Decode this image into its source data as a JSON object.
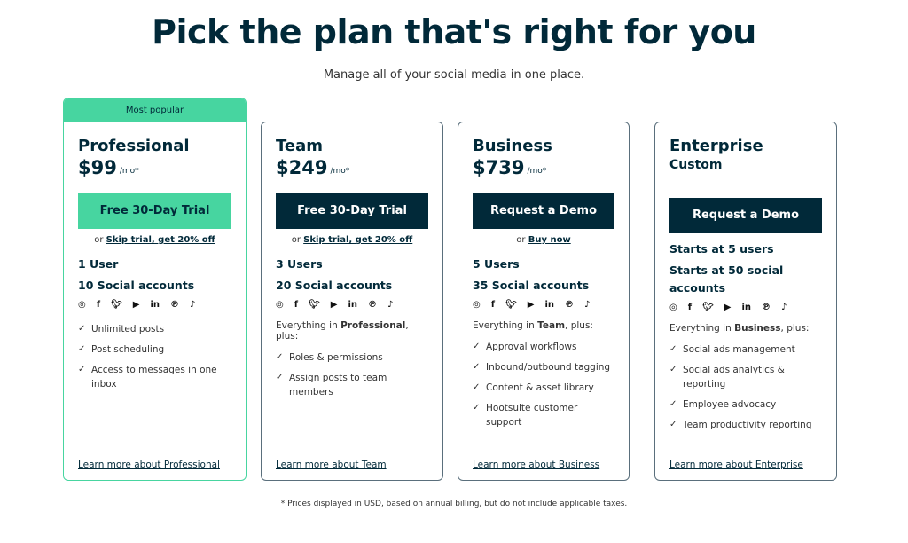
{
  "header": {
    "title": "Pick the plan that's right for you",
    "subtitle": "Manage all of your social media in one place."
  },
  "colors": {
    "primary": "#012939",
    "accent": "#47d5a0"
  },
  "social_icons": [
    "instagram-icon",
    "facebook-icon",
    "twitter-icon",
    "youtube-icon",
    "linkedin-icon",
    "pinterest-icon",
    "tiktok-icon"
  ],
  "plans": [
    {
      "badge": "Most popular",
      "name": "Professional",
      "price": "$99",
      "per": "/mo*",
      "button": "Free 30-Day Trial",
      "or": "or",
      "alt_link": "Skip trial, get 20% off",
      "users": "1 User",
      "accounts": "10 Social accounts",
      "features": [
        "Unlimited posts",
        "Post scheduling",
        "Access to messages in one inbox"
      ],
      "learn": "Learn more about Professional"
    },
    {
      "name": "Team",
      "price": "$249",
      "per": "/mo*",
      "button": "Free 30-Day Trial",
      "or": "or",
      "alt_link": "Skip trial, get 20% off",
      "users": "3 Users",
      "accounts": "20 Social accounts",
      "every_pre": "Everything in ",
      "every_plan": "Professional",
      "every_post": ", plus:",
      "features": [
        "Roles & permissions",
        "Assign posts to team members"
      ],
      "learn": "Learn more about Team"
    },
    {
      "name": "Business",
      "price": "$739",
      "per": "/mo*",
      "button": "Request a Demo",
      "or": "or",
      "alt_link": "Buy now",
      "users": "5 Users",
      "accounts": "35 Social accounts",
      "every_pre": "Everything in ",
      "every_plan": "Team",
      "every_post": ", plus:",
      "features": [
        "Approval workflows",
        "Inbound/outbound tagging",
        "Content & asset library",
        "Hootsuite customer support"
      ],
      "learn": "Learn more about Business"
    },
    {
      "name": "Enterprise",
      "price": "Custom",
      "button": "Request a Demo",
      "users": "Starts at 5 users",
      "accounts": "Starts at 50 social accounts",
      "every_pre": "Everything in ",
      "every_plan": "Business",
      "every_post": ", plus:",
      "features": [
        "Social ads management",
        "Social ads analytics & reporting",
        "Employee advocacy",
        "Team productivity reporting"
      ],
      "learn": "Learn more about Enterprise"
    }
  ],
  "footnote": "* Prices displayed in USD, based on annual billing, but do not include applicable taxes."
}
